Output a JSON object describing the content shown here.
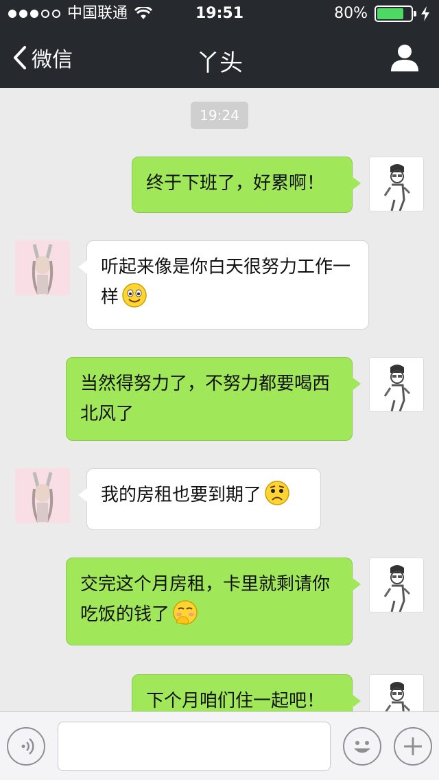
{
  "status_bar": {
    "carrier": "中国联通",
    "time": "19:51",
    "battery": "80%",
    "battery_level": 0.8
  },
  "nav": {
    "back_label": "微信",
    "title": "丫头",
    "back_icon": "chevron-left-icon",
    "profile_icon": "person-icon"
  },
  "chat": {
    "timestamp": "19:24",
    "messages": [
      {
        "from": "me",
        "text": "终于下班了，好累啊！"
      },
      {
        "from": "her",
        "text": "听起来像是你白天很努力工作一样",
        "emoji": "smile-emoji"
      },
      {
        "from": "me",
        "text": "当然得努力了，不努力都要喝西北风了"
      },
      {
        "from": "her",
        "text": "我的房租也要到期了",
        "emoji": "sad-emoji"
      },
      {
        "from": "me",
        "text": "交完这个月房租，卡里就剩请你吃饭的钱了",
        "emoji": "shy-emoji"
      },
      {
        "from": "me",
        "text": "下个月咱们住一起吧！"
      }
    ]
  },
  "input_bar": {
    "voice_icon": "voice-icon",
    "emoji_icon": "emoji-icon",
    "plus_icon": "plus-icon",
    "placeholder": ""
  },
  "colors": {
    "nav_bg": "#26292e",
    "my_bubble": "#a0e75a",
    "her_bubble": "#ffffff",
    "chat_bg": "#ebebeb"
  }
}
